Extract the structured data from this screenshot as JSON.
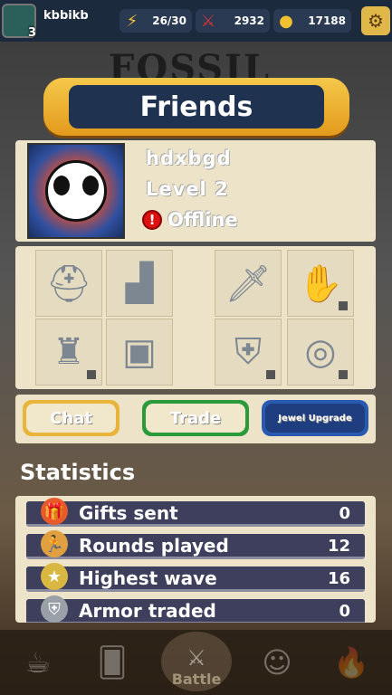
{
  "player": {
    "name": "kbbikb",
    "level": "3"
  },
  "resources": [
    {
      "icon": "lightning-icon",
      "value": "26/30"
    },
    {
      "icon": "crossed-swords-icon",
      "value": "2932"
    },
    {
      "icon": "gold-coins-icon",
      "value": "17188"
    }
  ],
  "background_title": "FOSSIL",
  "page_title": "Friends",
  "friend": {
    "name": "hdxbgd",
    "level": "Level 2",
    "status": "Offline"
  },
  "buttons": {
    "chat": "Chat",
    "trade": "Trade",
    "jewel": "Jewel Upgrade"
  },
  "stats": {
    "title": "Statistics",
    "rows": [
      {
        "label": "Gifts sent",
        "value": "0"
      },
      {
        "label": "Rounds played",
        "value": "12"
      },
      {
        "label": "Highest wave",
        "value": "16"
      },
      {
        "label": "Armor traded",
        "value": "0"
      }
    ]
  },
  "nav": {
    "battle": "Battle"
  }
}
